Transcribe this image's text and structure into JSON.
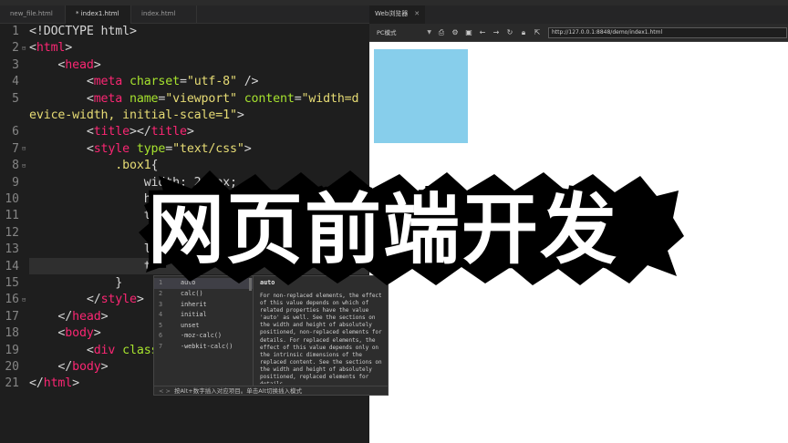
{
  "editor": {
    "tabs": [
      {
        "label": "new_file.html"
      },
      {
        "label": "* index1.html"
      },
      {
        "label": "index.html"
      }
    ],
    "lines": [
      {
        "n": "1"
      },
      {
        "n": "2"
      },
      {
        "n": "3"
      },
      {
        "n": "4"
      },
      {
        "n": "5"
      },
      {
        "n": ""
      },
      {
        "n": "6"
      },
      {
        "n": "7"
      },
      {
        "n": "8"
      },
      {
        "n": "9"
      },
      {
        "n": "10"
      },
      {
        "n": "11"
      },
      {
        "n": "12"
      },
      {
        "n": "13"
      },
      {
        "n": "14"
      },
      {
        "n": "15"
      },
      {
        "n": "16"
      },
      {
        "n": "17"
      },
      {
        "n": "18"
      },
      {
        "n": "19"
      },
      {
        "n": "20"
      },
      {
        "n": "21"
      }
    ],
    "code": {
      "l1_doctype": "<!DOCTYPE html>",
      "l2_open": "<",
      "l2_tag": "html",
      "l2_close": ">",
      "l3_open": "<",
      "l3_tag": "head",
      "l3_close": ">",
      "l4_open": "<",
      "l4_tag": "meta",
      "l4_attr": "charset",
      "l4_eq": "=",
      "l4_val": "\"utf-8\"",
      "l4_close": " />",
      "l5_open": "<",
      "l5_tag": "meta",
      "l5_attr1": "name",
      "l5_eq1": "=",
      "l5_val1": "\"viewport\"",
      "l5_attr2": "content",
      "l5_eq2": "=",
      "l5_val2a": "\"width=d",
      "l5b_val": "evice-width, initial-scale=1\"",
      "l5b_close": ">",
      "l6_open": "<",
      "l6_tag": "title",
      "l6_mid": "></",
      "l6_tag2": "title",
      "l6_close": ">",
      "l7_open": "<",
      "l7_tag": "style",
      "l7_attr": "type",
      "l7_eq": "=",
      "l7_val": "\"text/css\"",
      "l7_close": ">",
      "l8_sel": ".box1",
      "l8_brace": "{",
      "l9_prop": "width: 200px;",
      "l10_prop": "h",
      "l11_prop": "t",
      "l12_prop": "p",
      "l13_prop": "l",
      "l14_prop": "t",
      "l15_brace": "}",
      "l16_open": "</",
      "l16_tag": "style",
      "l16_close": ">",
      "l17_open": "</",
      "l17_tag": "head",
      "l17_close": ">",
      "l18_open": "<",
      "l18_tag": "body",
      "l18_close": ">",
      "l19_open": "<",
      "l19_tag": "div",
      "l19_attr": "class",
      "l20_open": "</",
      "l20_tag": "body",
      "l20_close": ">",
      "l21_open": "</",
      "l21_tag": "html",
      "l21_close": ">"
    }
  },
  "autocomplete": {
    "items": [
      {
        "num": "1",
        "text": "auto"
      },
      {
        "num": "2",
        "text": "calc()"
      },
      {
        "num": "3",
        "text": "inherit"
      },
      {
        "num": "4",
        "text": "initial"
      },
      {
        "num": "5",
        "text": "unset"
      },
      {
        "num": "6",
        "text": "-moz-calc()"
      },
      {
        "num": "7",
        "text": "-webkit-calc()"
      }
    ],
    "doc_title": "auto",
    "doc_text": "For non-replaced elements, the effect of this value depends on which of related properties have the value 'auto' as well. See the sections on the width and height of absolutely positioned, non-replaced elements for details. For replaced elements, the effect of this value depends only on the intrinsic dimensions of the replaced content. See the sections on the width and height of absolutely positioned, replaced elements for details",
    "footer_nav": "< >",
    "footer_hint": "按Alt+数字插入对应项目。单击Alt切换插入模式"
  },
  "browser": {
    "tab_label": "Web浏览器",
    "tab_close": "✕",
    "mode": "PC模式",
    "mode_caret": "▼",
    "url": "http://127.0.0.1:8848/demo/index1.html",
    "toolbar_icons": [
      "screenshot-icon",
      "settings-icon",
      "capture-icon",
      "back-icon",
      "forward-icon",
      "refresh-icon",
      "lock-icon",
      "open-external-icon"
    ],
    "box_color": "#87ceeb"
  },
  "overlay": {
    "title": "网页前端开发"
  }
}
